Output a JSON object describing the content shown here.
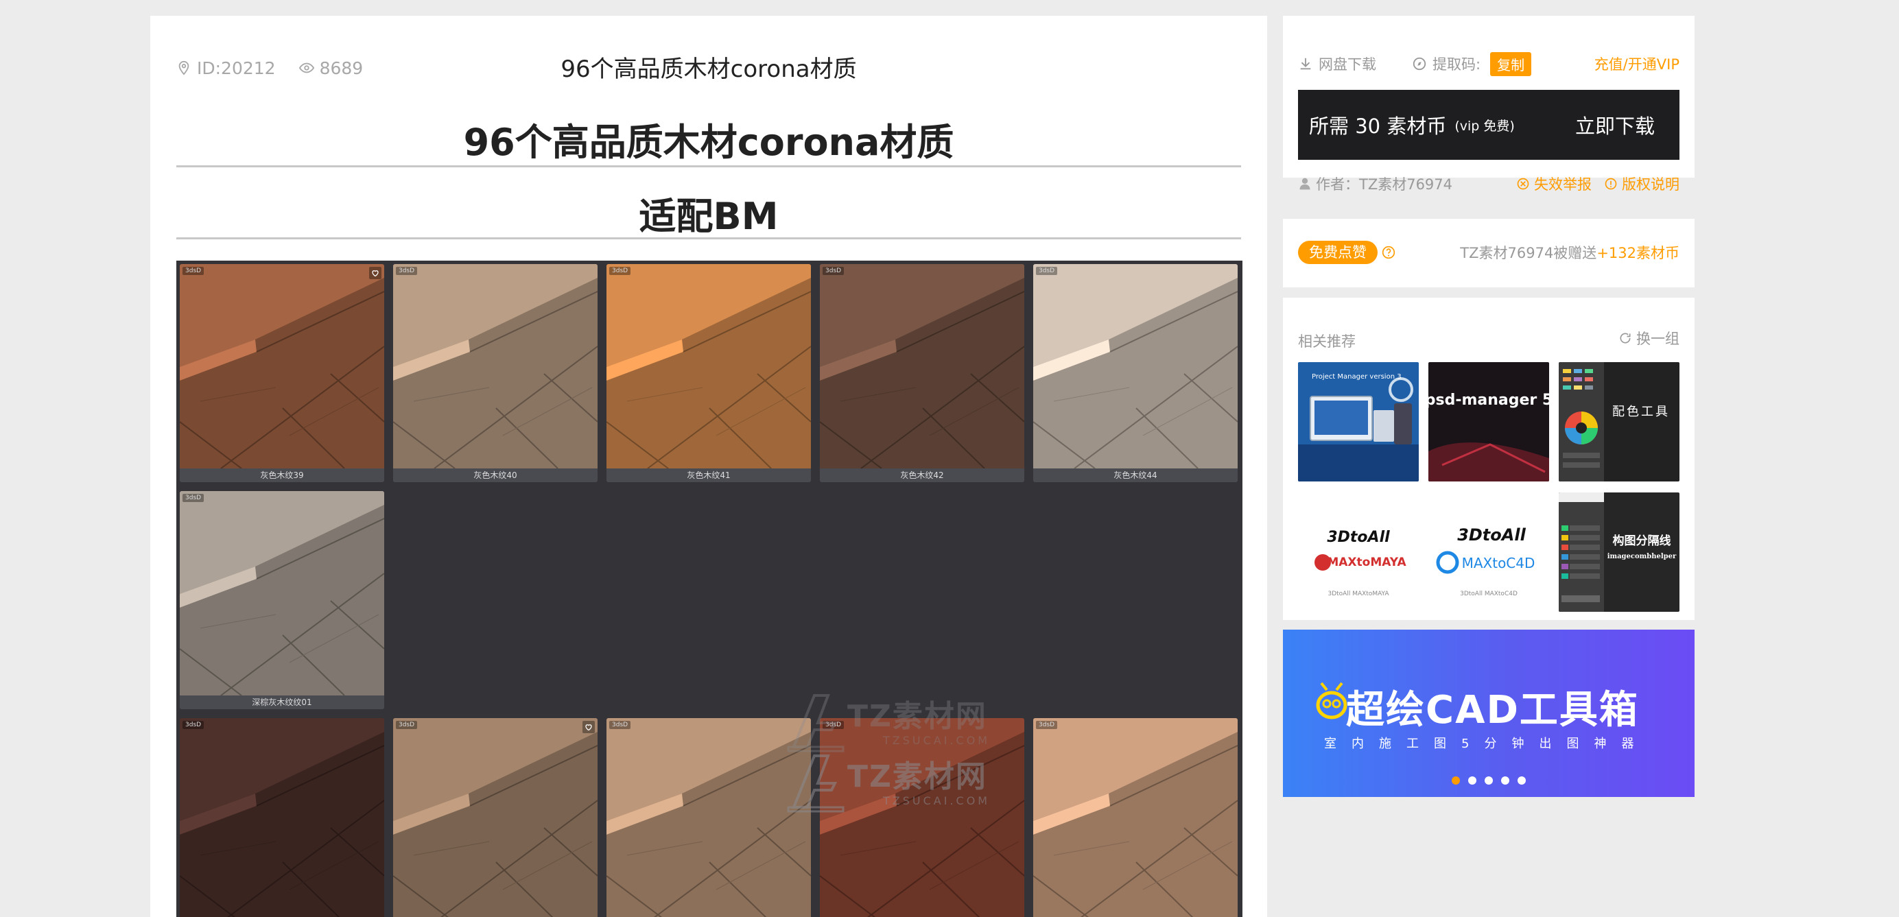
{
  "page": {
    "top_title": "96个高品质木材corona材质",
    "meta": {
      "id": "ID:20212",
      "views": "8689"
    },
    "heading": "96个高品质木材corona材质",
    "subheading": "适配BM"
  },
  "gallery": {
    "watermark": {
      "title": "TZ素材网",
      "sub": "TZSUCAI.COM"
    },
    "badge_text": "3dsD",
    "tiles": [
      {
        "caption": "灰色木纹39",
        "color": "#7a4a32"
      },
      {
        "caption": "灰色木纹40",
        "color": "#8a7563"
      },
      {
        "caption": "灰色木纹41",
        "color": "#a0683a"
      },
      {
        "caption": "灰色木纹42",
        "color": "#5a4034"
      },
      {
        "caption": "灰色木纹44",
        "color": "#9e9388"
      },
      {
        "caption": "深棕灰木纹纹01",
        "color": "#807870"
      },
      {
        "caption": "",
        "color": "#3a2420"
      },
      {
        "caption": "",
        "color": "#7a6350"
      },
      {
        "caption": "",
        "color": "#8c705a"
      },
      {
        "caption": "",
        "color": "#6a3426"
      },
      {
        "caption": "",
        "color": "#9a7860"
      }
    ]
  },
  "sidebar": {
    "download": {
      "netdisk_label": "网盘下载",
      "code_label": "提取码:",
      "copy_label": "复制",
      "vip_link": "充值/开通VIP",
      "need_coins": "所需 30 素材币",
      "vip_free": "(vip 免费)",
      "download_now": "立即下载",
      "author": "作者：TZ素材76974",
      "report": "失效举报",
      "copyright": "版权说明"
    },
    "like": {
      "button": "免费点赞",
      "gift_text": "TZ素材76974被赠送",
      "gift_amount": "+132素材币"
    },
    "recommend": {
      "title": "相关推荐",
      "swap": "换一组",
      "items": [
        {
          "label": "Project Manager version 3"
        },
        {
          "label": "psd-manager 5"
        },
        {
          "label": "配色工具"
        },
        {
          "label": "3DtoAll MAXtoMAYA"
        },
        {
          "label": "3DtoAll MAXtoC4D"
        },
        {
          "label": "构图分隔线",
          "sub": "imagecombhelper"
        }
      ]
    },
    "banner": {
      "title": "超绘CAD工具箱",
      "subtitle": "室内施工图5分钟出图神器"
    }
  },
  "colors": {
    "accent": "#ff9c00",
    "dark": "#1e1e20",
    "gallery_bg": "#333338"
  }
}
